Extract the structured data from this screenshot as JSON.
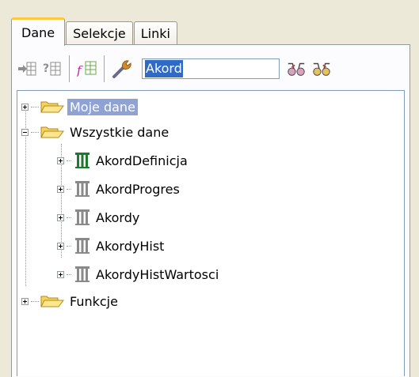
{
  "tabs": [
    {
      "label": "Dane",
      "active": true
    },
    {
      "label": "Selekcje",
      "active": false
    },
    {
      "label": "Linki",
      "active": false
    }
  ],
  "search": {
    "value": "Akord"
  },
  "tree": {
    "root_items": [
      {
        "label": "Moje dane",
        "selected": true,
        "expanded": false
      },
      {
        "label": "Wszystkie dane",
        "expanded": true
      },
      {
        "label": "Funkcje",
        "expanded": false
      }
    ],
    "tables": [
      {
        "label": "AkordDefinicja",
        "icon": "table-icon-green"
      },
      {
        "label": "AkordProgres",
        "icon": "table-icon-gray"
      },
      {
        "label": "Akordy",
        "icon": "table-icon-gray"
      },
      {
        "label": "AkordyHist",
        "icon": "table-icon-gray"
      },
      {
        "label": "AkordyHistWartosci",
        "icon": "table-icon-gray"
      }
    ]
  },
  "colors": {
    "tab_accent": "#ffc83c",
    "selection": "#8fa2d6",
    "input_selection": "#316ac5",
    "folder": "#f7d35a"
  }
}
